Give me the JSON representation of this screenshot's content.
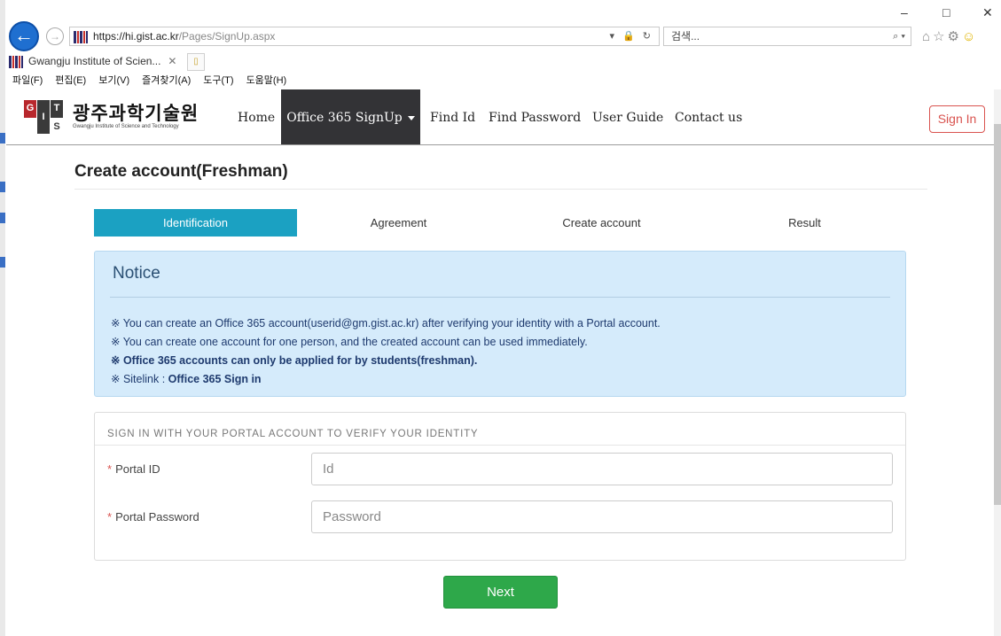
{
  "browser": {
    "url_host": "https://hi.gist.ac.kr",
    "url_path": "/Pages/SignUp.aspx",
    "search_placeholder": "검색...",
    "tab_title": "Gwangju Institute of Scien...",
    "menu": [
      "파일(F)",
      "편집(E)",
      "보기(V)",
      "즐겨찾기(A)",
      "도구(T)",
      "도움말(H)"
    ]
  },
  "site": {
    "logo_ko": "광주과학기술원",
    "logo_en": "Gwangju Institute of Science and Technology",
    "nav": [
      "Home",
      "Office 365 SignUp",
      "Find Id",
      "Find Password",
      "User Guide",
      "Contact us"
    ],
    "signin_label": "Sign In"
  },
  "page": {
    "title": "Create account(Freshman)",
    "steps": [
      "Identification",
      "Agreement",
      "Create account",
      "Result"
    ],
    "active_step": 0
  },
  "notice": {
    "title": "Notice",
    "line1": "※ You can create an Office 365 account(userid@gm.gist.ac.kr) after verifying your identity with a Portal account.",
    "line2": "※ You can create one account for one person, and the created account can be used immediately.",
    "line3": "※ Office 365 accounts can only be applied for by students(freshman).",
    "line4_prefix": "※ Sitelink : ",
    "line4_link": "Office 365 Sign in"
  },
  "form": {
    "heading": "SIGN IN WITH YOUR PORTAL ACCOUNT TO VERIFY YOUR IDENTITY",
    "required_mark": "*",
    "id_label": "Portal ID",
    "id_placeholder": "Id",
    "pw_label": "Portal Password",
    "pw_placeholder": "Password",
    "next_label": "Next"
  },
  "colors": {
    "step_active": "#1ba1c2",
    "nav_active": "#333336",
    "next_button": "#2ea84a",
    "signin_border": "#d9534f",
    "notice_bg": "#d5ebfb"
  }
}
